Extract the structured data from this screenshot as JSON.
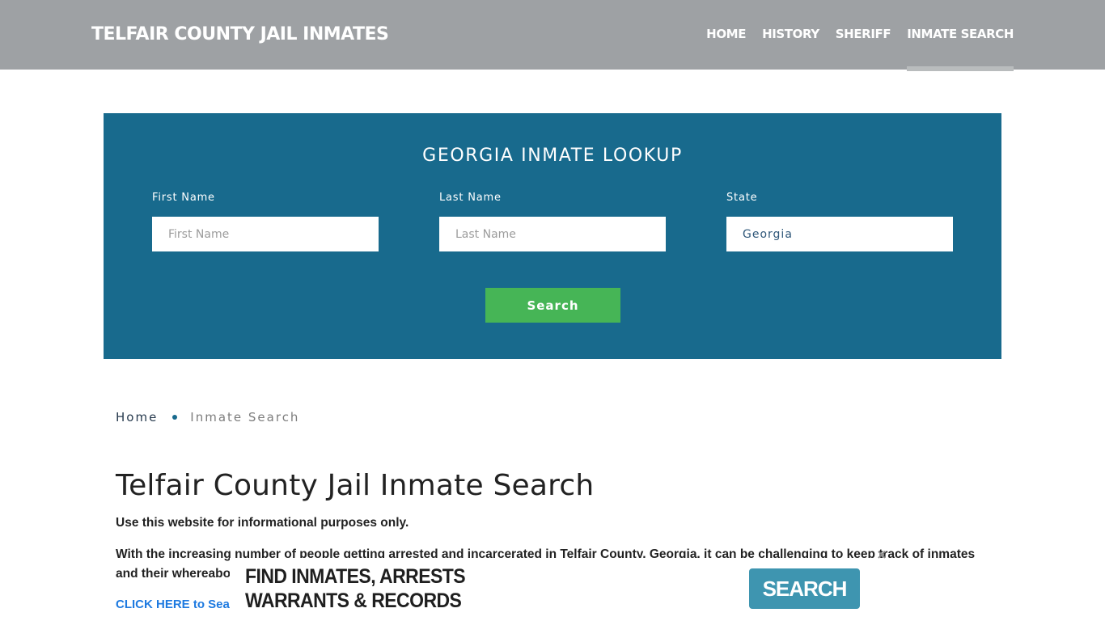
{
  "header": {
    "site_title": "TELFAIR COUNTY JAIL INMATES",
    "nav": [
      {
        "label": "HOME",
        "active": false
      },
      {
        "label": "HISTORY",
        "active": false
      },
      {
        "label": "SHERIFF",
        "active": false
      },
      {
        "label": "INMATE SEARCH",
        "active": true
      }
    ]
  },
  "lookup": {
    "title": "GEORGIA INMATE LOOKUP",
    "first_name": {
      "label": "First Name",
      "placeholder": "First Name",
      "value": ""
    },
    "last_name": {
      "label": "Last Name",
      "placeholder": "Last Name",
      "value": ""
    },
    "state": {
      "label": "State",
      "value": "Georgia"
    },
    "search_label": "Search",
    "colors": {
      "panel": "#186a8d",
      "button": "#46b556"
    }
  },
  "breadcrumb": {
    "home": "Home",
    "current": "Inmate Search"
  },
  "main": {
    "title": "Telfair County Jail Inmate Search",
    "disclaimer": "Use this website for informational purposes only.",
    "intro": "With the increasing number of people getting arrested and incarcerated in Telfair County, Georgia, it can be challenging to keep track of inmates and their whereabouts. convenient.",
    "link_text": "CLICK HERE to Sea"
  },
  "ad": {
    "line1": "FIND INMATES, ARRESTS",
    "line2": "WARRANTS & RECORDS",
    "button_label": "SEARCH",
    "close_icon": "close-icon",
    "button_color": "#3e95b0"
  }
}
